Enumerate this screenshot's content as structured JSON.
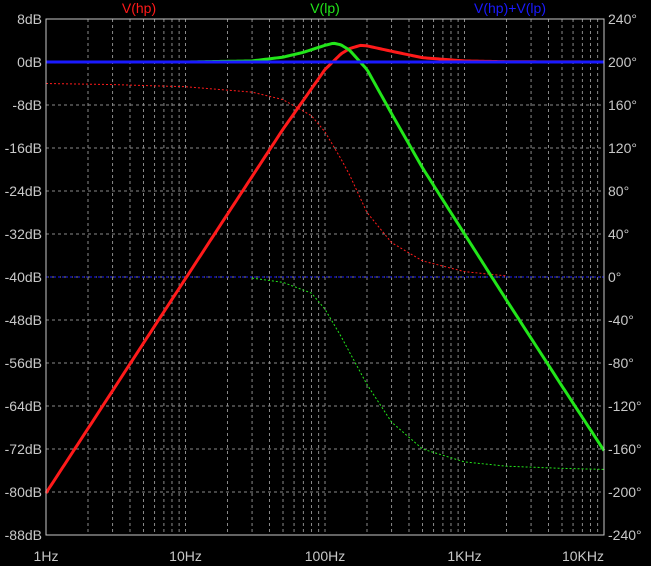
{
  "colors": {
    "background": "#000000",
    "frame": "#c8c8c8",
    "grid": "#8a8a8a",
    "hp": "#ff1a1a",
    "lp": "#22e61a",
    "sum": "#1a1aff"
  },
  "chart_data": {
    "type": "line",
    "title": "",
    "x_scale": "log",
    "xlim": [
      1,
      10000
    ],
    "ylim_left": [
      -88,
      8
    ],
    "ylim_right": [
      -240,
      240
    ],
    "grid": true,
    "legend_placement": "top",
    "x_tick_labels": [
      "1Hz",
      "10Hz",
      "100Hz",
      "1KHz",
      "10KHz"
    ],
    "y_left_tick_labels": [
      "8dB",
      "0dB",
      "-8dB",
      "-16dB",
      "-24dB",
      "-32dB",
      "-40dB",
      "-48dB",
      "-56dB",
      "-64dB",
      "-72dB",
      "-80dB",
      "-88dB"
    ],
    "y_right_tick_labels": [
      "240°",
      "200°",
      "160°",
      "120°",
      "80°",
      "40°",
      "0°",
      "-40°",
      "-80°",
      "-120°",
      "-160°",
      "-200°",
      "-240°"
    ],
    "series": [
      {
        "name": "V(hp)",
        "key": "hp",
        "color": "#ff1a1a",
        "magnitude": [
          [
            1,
            -80.2
          ],
          [
            2,
            -68.2
          ],
          [
            5,
            -52.3
          ],
          [
            10,
            -40.3
          ],
          [
            20,
            -28.3
          ],
          [
            50,
            -12.5
          ],
          [
            100,
            -1.4
          ],
          [
            130,
            1.5
          ],
          [
            150,
            2.5
          ],
          [
            180,
            3.1
          ],
          [
            200,
            3.0
          ],
          [
            300,
            2.0
          ],
          [
            500,
            0.8
          ],
          [
            1000,
            0.2
          ],
          [
            2000,
            0.05
          ],
          [
            10000,
            0.0
          ]
        ],
        "phase": [
          [
            1,
            180
          ],
          [
            3,
            179
          ],
          [
            10,
            177
          ],
          [
            30,
            172
          ],
          [
            50,
            165
          ],
          [
            80,
            150
          ],
          [
            100,
            135
          ],
          [
            130,
            110
          ],
          [
            150,
            95
          ],
          [
            200,
            60
          ],
          [
            300,
            32
          ],
          [
            500,
            15
          ],
          [
            1000,
            5
          ],
          [
            2000,
            1
          ]
        ]
      },
      {
        "name": "V(lp)",
        "key": "lp",
        "color": "#22e61a",
        "magnitude": [
          [
            1,
            0.0
          ],
          [
            10,
            0.0
          ],
          [
            30,
            0.2
          ],
          [
            50,
            0.9
          ],
          [
            70,
            1.8
          ],
          [
            100,
            3.1
          ],
          [
            115,
            3.5
          ],
          [
            130,
            3.2
          ],
          [
            150,
            2.2
          ],
          [
            200,
            -1.4
          ],
          [
            300,
            -9.6
          ],
          [
            500,
            -19.7
          ],
          [
            1000,
            -32.0
          ],
          [
            2000,
            -44.3
          ],
          [
            5000,
            -60.3
          ],
          [
            10000,
            -72.3
          ]
        ],
        "phase": [
          [
            30,
            -1
          ],
          [
            50,
            -5
          ],
          [
            80,
            -15
          ],
          [
            100,
            -30
          ],
          [
            130,
            -55
          ],
          [
            150,
            -70
          ],
          [
            200,
            -100
          ],
          [
            300,
            -135
          ],
          [
            500,
            -160
          ],
          [
            1000,
            -172
          ],
          [
            2000,
            -176
          ],
          [
            5000,
            -178
          ],
          [
            10000,
            -179
          ]
        ]
      },
      {
        "name": "V(hp)+V(lp)",
        "key": "sum",
        "color": "#1a1aff",
        "magnitude": [
          [
            1,
            0.0
          ],
          [
            10000,
            0.0
          ]
        ],
        "phase": [
          [
            1,
            0
          ],
          [
            10000,
            0
          ]
        ]
      }
    ]
  }
}
